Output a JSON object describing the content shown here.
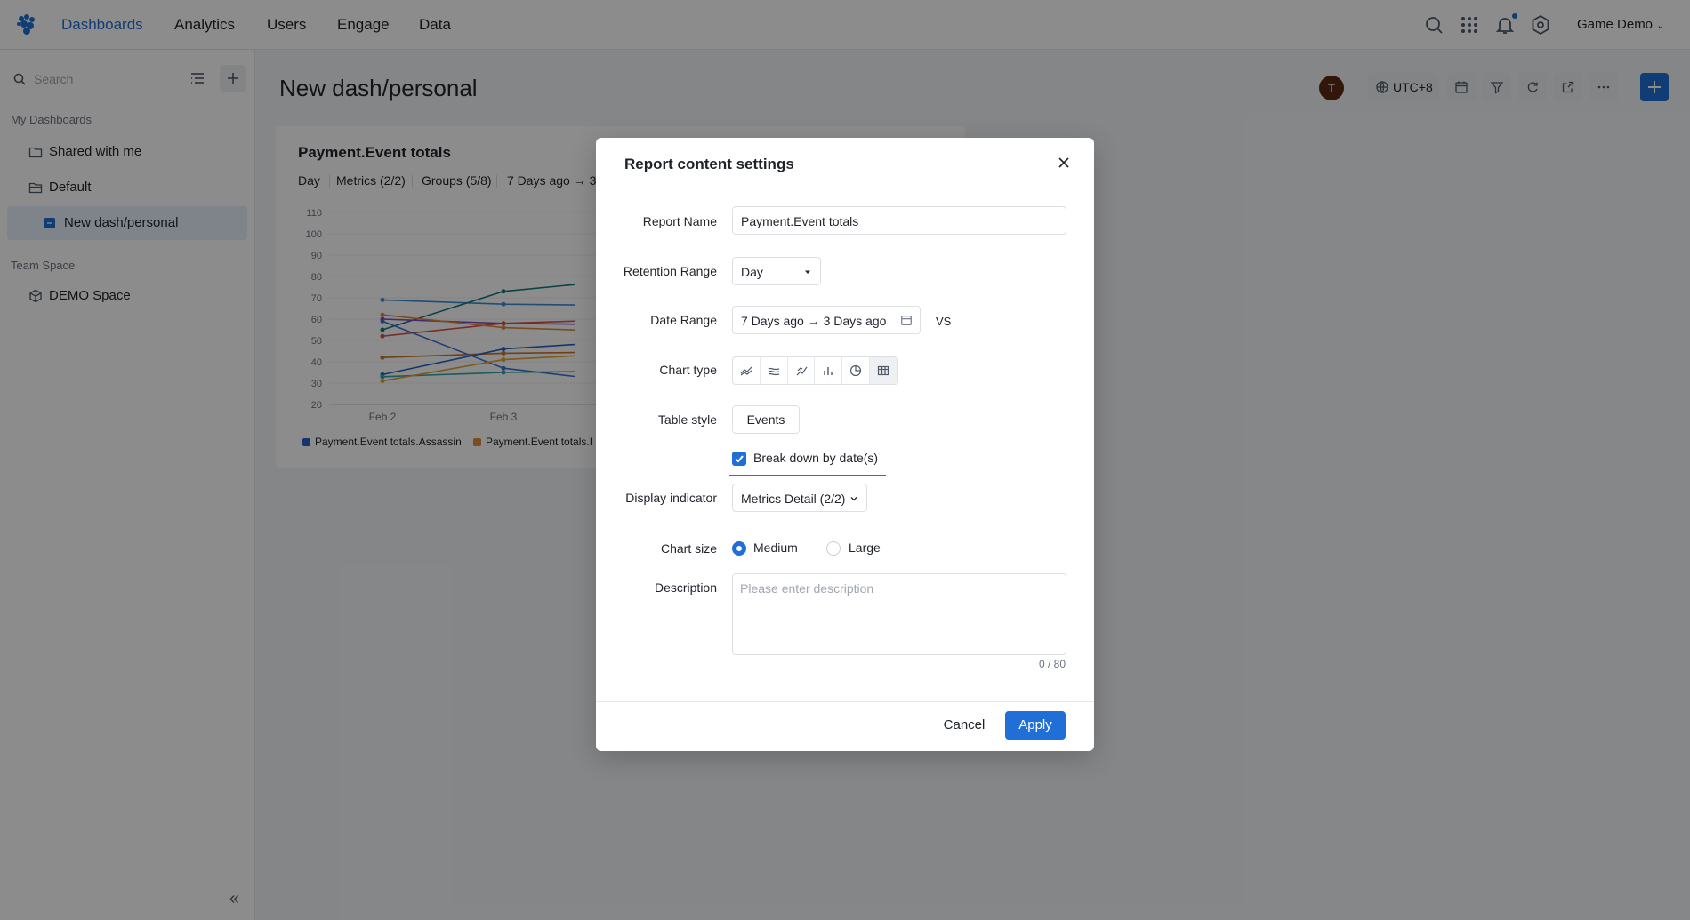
{
  "nav": {
    "items": [
      "Dashboards",
      "Analytics",
      "Users",
      "Engage",
      "Data"
    ],
    "project": "Game Demo"
  },
  "sidebar": {
    "search_placeholder": "Search",
    "my_dashboards_label": "My Dashboards",
    "items": [
      "Shared with me",
      "Default",
      "New dash/personal"
    ],
    "team_space_label": "Team Space",
    "team_items": [
      "DEMO Space"
    ],
    "collapse_glyph": "«"
  },
  "header": {
    "title": "New dash/personal",
    "avatar_initial": "T",
    "timezone": "UTC+8"
  },
  "card": {
    "title": "Payment.Event totals",
    "chips": [
      "Day",
      "Metrics (2/2)",
      "Groups (5/8)",
      "7 Days ago → 3"
    ],
    "legend": [
      "Payment.Event totals.Assassin",
      "Payment.Event totals.I"
    ]
  },
  "chart_data": {
    "type": "line",
    "categories": [
      "Feb 2",
      "Feb 3"
    ],
    "ylim": [
      20,
      110
    ],
    "yticks": [
      110,
      100,
      90,
      80,
      70,
      60,
      50,
      40,
      30,
      20
    ],
    "series": [
      {
        "color": "#3a8fd6",
        "values": [
          69,
          67
        ]
      },
      {
        "color": "#137a7f",
        "values": [
          55,
          73
        ]
      },
      {
        "color": "#7a4fc9",
        "values": [
          60,
          58
        ]
      },
      {
        "color": "#d9534f",
        "values": [
          52,
          58
        ]
      },
      {
        "color": "#e08a3a",
        "values": [
          62,
          56
        ]
      },
      {
        "color": "#c8762b",
        "values": [
          42,
          44
        ]
      },
      {
        "color": "#2c5fc7",
        "values": [
          34,
          46
        ]
      },
      {
        "color": "#3d73d8",
        "values": [
          59,
          37
        ]
      },
      {
        "color": "#2fa6a0",
        "values": [
          33,
          35
        ]
      },
      {
        "color": "#e0a23a",
        "values": [
          31,
          41
        ]
      }
    ]
  },
  "modal": {
    "title": "Report content settings",
    "report_name_label": "Report Name",
    "report_name_value": "Payment.Event totals",
    "retention_label": "Retention Range",
    "retention_value": "Day",
    "date_label": "Date Range",
    "date_value": "7 Days ago → 3 Days ago",
    "vs": "VS",
    "chart_type_label": "Chart type",
    "table_style_label": "Table style",
    "table_style_value": "Events",
    "breakdown_label": "Break down by date(s)",
    "indicator_label": "Display indicator",
    "indicator_value": "Metrics Detail (2/2)",
    "chart_size_label": "Chart size",
    "size_options": [
      "Medium",
      "Large"
    ],
    "description_label": "Description",
    "description_placeholder": "Please enter description",
    "counter": "0 / 80",
    "cancel": "Cancel",
    "apply": "Apply"
  }
}
